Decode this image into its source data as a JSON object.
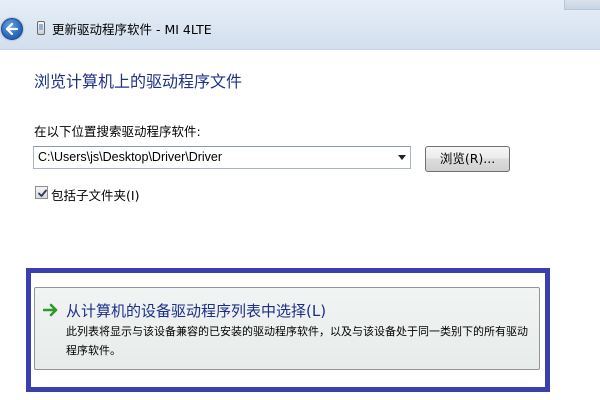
{
  "window": {
    "title": "更新驱动程序软件 - MI 4LTE"
  },
  "page": {
    "heading": "浏览计算机上的驱动程序文件",
    "search_label": "在以下位置搜索驱动程序软件:",
    "path_value": "C:\\Users\\js\\Desktop\\Driver\\Driver",
    "browse_label": "浏览(R)...",
    "include_subfolders_label": "包括子文件夹(I)",
    "include_subfolders_checked": true
  },
  "command_link": {
    "title": "从计算机的设备驱动程序列表中选择(L)",
    "description": "此列表将显示与该设备兼容的已安装的驱动程序软件，以及与该设备处于同一类别下的所有驱动程序软件。"
  },
  "colors": {
    "heading": "#1e3287",
    "highlight_frame": "#3a3fb0",
    "arrow": "#2e9a2e"
  },
  "icons": {
    "back": "back-arrow-icon",
    "device": "device-icon",
    "command_arrow": "green-arrow-icon",
    "dropdown": "chevron-down-icon",
    "check": "checkmark-icon"
  }
}
